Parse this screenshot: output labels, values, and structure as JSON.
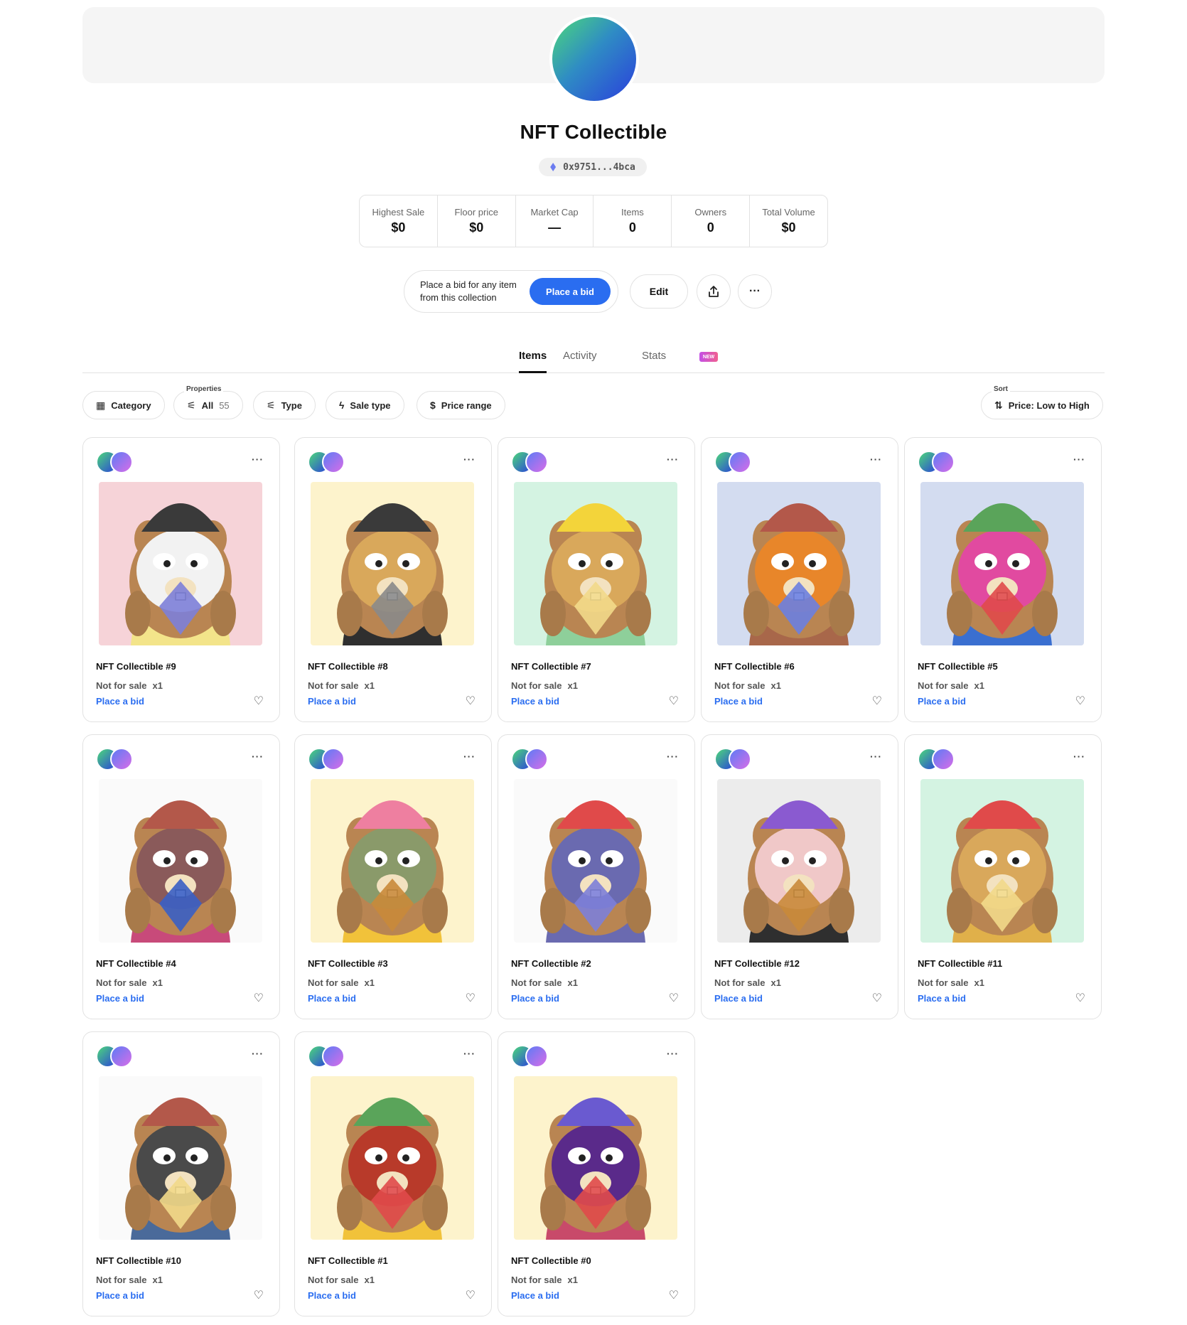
{
  "collection": {
    "name": "NFT Collectible",
    "address": "0x9751...4bca"
  },
  "stats": [
    {
      "label": "Highest Sale",
      "value": "$0"
    },
    {
      "label": "Floor price",
      "value": "$0"
    },
    {
      "label": "Market Cap",
      "value": "—"
    },
    {
      "label": "Items",
      "value": "0"
    },
    {
      "label": "Owners",
      "value": "0"
    },
    {
      "label": "Total Volume",
      "value": "$0"
    }
  ],
  "actions": {
    "bid_prompt": "Place a bid for any item from this collection",
    "bid_button": "Place a bid",
    "edit_button": "Edit",
    "share_icon": "share-icon",
    "more_icon": "more-icon"
  },
  "tabs": {
    "items": "Items",
    "activity": "Activity",
    "new_badge": "NEW",
    "stats": "Stats"
  },
  "filters": {
    "category": "Category",
    "properties_caption": "Properties",
    "all": "All",
    "all_count": "55",
    "type": "Type",
    "sale_type": "Sale type",
    "price_range": "Price range",
    "sort_caption": "Sort",
    "sort_value": "Price: Low to High"
  },
  "card_labels": {
    "not_for_sale": "Not for sale",
    "quantity": "x1",
    "place_bid": "Place a bid"
  },
  "items": [
    {
      "title": "NFT Collectible #9",
      "bg": "#f6d3d8",
      "fur": "#f2f2f2",
      "hat": "#3a3a3a",
      "shirt": "#f3e48a",
      "hold": "#7d7fd8"
    },
    {
      "title": "NFT Collectible #8",
      "bg": "#fdf3cc",
      "fur": "#d9a85b",
      "hat": "#3a3a3a",
      "shirt": "#2f2f2f",
      "hold": "#8a8a8a"
    },
    {
      "title": "NFT Collectible #7",
      "bg": "#d4f3e2",
      "fur": "#d9a85b",
      "hat": "#f3d43a",
      "shirt": "#8ecf9a",
      "hold": "#f2d98a"
    },
    {
      "title": "NFT Collectible #6",
      "bg": "#d3dcf0",
      "fur": "#e8862a",
      "hat": "#b3584a",
      "shirt": "#a8674a",
      "hold": "#6c7fe0"
    },
    {
      "title": "NFT Collectible #5",
      "bg": "#d3dcf0",
      "fur": "#e14aa0",
      "hat": "#5aa45a",
      "shirt": "#3a6fd0",
      "hold": "#e04a4a"
    },
    {
      "title": "NFT Collectible #4",
      "bg": "#fafafa",
      "fur": "#8a5a5a",
      "hat": "#b3584a",
      "shirt": "#c84a7a",
      "hold": "#3a5fc4"
    },
    {
      "title": "NFT Collectible #3",
      "bg": "#fdf3cc",
      "fur": "#8a9a6a",
      "hat": "#ee7fa0",
      "shirt": "#f1c23a",
      "hold": "#c98a3a"
    },
    {
      "title": "NFT Collectible #2",
      "bg": "#fafafa",
      "fur": "#6a6ab0",
      "hat": "#e04a4a",
      "shirt": "#6a6ab0",
      "hold": "#7d7fd8"
    },
    {
      "title": "NFT Collectible #12",
      "bg": "#ececec",
      "fur": "#f0c8c8",
      "hat": "#8a5ad0",
      "shirt": "#2f2f2f",
      "hold": "#c98a3a"
    },
    {
      "title": "NFT Collectible #11",
      "bg": "#d4f3e2",
      "fur": "#d9a85b",
      "hat": "#e04a4a",
      "shirt": "#e0b04a",
      "hold": "#f2d98a"
    },
    {
      "title": "NFT Collectible #10",
      "bg": "#fafafa",
      "fur": "#4a4a4a",
      "hat": "#b3584a",
      "shirt": "#4a6a9a",
      "hold": "#f2d98a"
    },
    {
      "title": "NFT Collectible #1",
      "bg": "#fdf3cc",
      "fur": "#b83a2a",
      "hat": "#5aa45a",
      "shirt": "#f1c23a",
      "hold": "#e04a4a"
    },
    {
      "title": "NFT Collectible #0",
      "bg": "#fdf3cc",
      "fur": "#5a2a8a",
      "hat": "#6a5ad0",
      "shirt": "#c84a6a",
      "hold": "#e04a4a"
    }
  ]
}
